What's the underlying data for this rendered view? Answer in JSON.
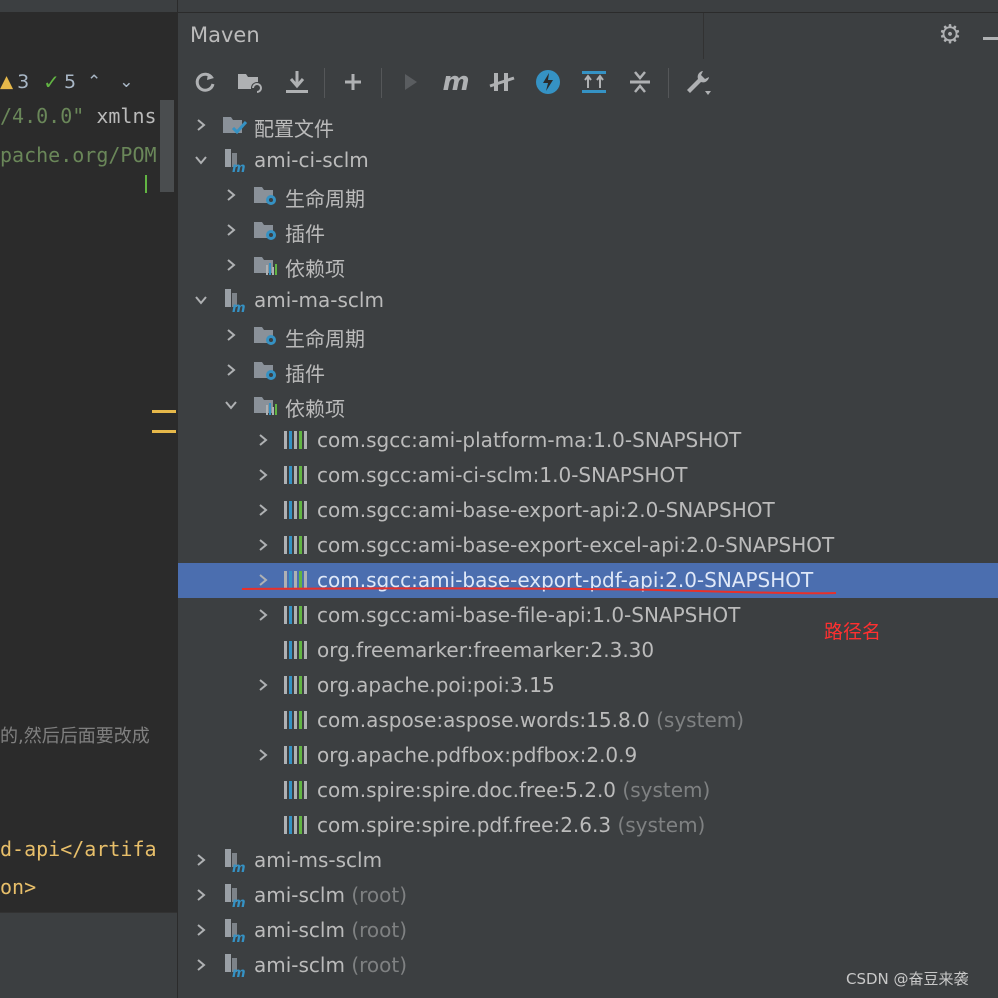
{
  "editor": {
    "inspection": {
      "warnings": "3",
      "checks": "5"
    },
    "code_lines": [
      {
        "text": "/4.0.0\"",
        "kind": "str"
      },
      {
        "text": " xmlns",
        "kind": "attr"
      },
      {
        "text": "pache.org/POM",
        "kind": "str"
      },
      {
        "text": "d-api</artifa",
        "kind": "tag"
      },
      {
        "text": "on>",
        "kind": "tag"
      }
    ],
    "comment": "的,然后后面要改成"
  },
  "maven": {
    "title": "Maven",
    "toolbar": [
      {
        "name": "reload-icon"
      },
      {
        "name": "generate-sources-icon"
      },
      {
        "name": "download-icon"
      },
      {
        "name": "add-icon"
      },
      {
        "name": "run-icon"
      },
      {
        "name": "execute-goal-icon",
        "text": "m"
      },
      {
        "name": "toggle-offline-icon"
      },
      {
        "name": "skip-tests-icon"
      },
      {
        "name": "show-dependencies-icon"
      },
      {
        "name": "collapse-all-icon"
      },
      {
        "name": "settings-wrench-icon"
      }
    ],
    "tree": [
      {
        "label": "配置文件",
        "icon": "profiles",
        "arrow": "collapsed",
        "level": 0
      },
      {
        "label": "ami-ci-sclm",
        "icon": "module",
        "arrow": "expanded",
        "level": 0
      },
      {
        "label": "生命周期",
        "icon": "folder-gear",
        "arrow": "collapsed",
        "level": 1
      },
      {
        "label": "插件",
        "icon": "folder-gear",
        "arrow": "collapsed",
        "level": 1
      },
      {
        "label": "依赖项",
        "icon": "folder-deps",
        "arrow": "collapsed",
        "level": 1
      },
      {
        "label": "ami-ma-sclm",
        "icon": "module",
        "arrow": "expanded",
        "level": 0
      },
      {
        "label": "生命周期",
        "icon": "folder-gear",
        "arrow": "collapsed",
        "level": 1
      },
      {
        "label": "插件",
        "icon": "folder-gear",
        "arrow": "collapsed",
        "level": 1
      },
      {
        "label": "依赖项",
        "icon": "folder-deps",
        "arrow": "expanded",
        "level": 1
      },
      {
        "label": "com.sgcc:ami-platform-ma:1.0-SNAPSHOT",
        "icon": "lib",
        "arrow": "collapsed",
        "level": 2
      },
      {
        "label": "com.sgcc:ami-ci-sclm:1.0-SNAPSHOT",
        "icon": "lib",
        "arrow": "collapsed",
        "level": 2
      },
      {
        "label": "com.sgcc:ami-base-export-api:2.0-SNAPSHOT",
        "icon": "lib",
        "arrow": "collapsed",
        "level": 2
      },
      {
        "label": "com.sgcc:ami-base-export-excel-api:2.0-SNAPSHOT",
        "icon": "lib",
        "arrow": "collapsed",
        "level": 2
      },
      {
        "label": "com.sgcc:ami-base-export-pdf-api:2.0-SNAPSHOT",
        "icon": "lib",
        "arrow": "collapsed",
        "level": 2,
        "selected": true
      },
      {
        "label": "com.sgcc:ami-base-file-api:1.0-SNAPSHOT",
        "icon": "lib",
        "arrow": "collapsed",
        "level": 2
      },
      {
        "label": "org.freemarker:freemarker:2.3.30",
        "icon": "lib",
        "arrow": "none",
        "level": 2
      },
      {
        "label": "org.apache.poi:poi:3.15",
        "icon": "lib",
        "arrow": "collapsed",
        "level": 2
      },
      {
        "label": "com.aspose:aspose.words:15.8.0",
        "suffix": "(system)",
        "icon": "lib",
        "arrow": "none",
        "level": 2
      },
      {
        "label": "org.apache.pdfbox:pdfbox:2.0.9",
        "icon": "lib",
        "arrow": "collapsed",
        "level": 2
      },
      {
        "label": "com.spire:spire.doc.free:5.2.0",
        "suffix": "(system)",
        "icon": "lib",
        "arrow": "none",
        "level": 2
      },
      {
        "label": "com.spire:spire.pdf.free:2.6.3",
        "suffix": "(system)",
        "icon": "lib",
        "arrow": "none",
        "level": 2
      },
      {
        "label": "ami-ms-sclm",
        "icon": "module",
        "arrow": "collapsed",
        "level": 0
      },
      {
        "label": "ami-sclm",
        "suffix": "(root)",
        "icon": "module",
        "arrow": "collapsed",
        "level": 0
      },
      {
        "label": "ami-sclm",
        "suffix": "(root)",
        "icon": "module",
        "arrow": "collapsed",
        "level": 0
      },
      {
        "label": "ami-sclm",
        "suffix": "(root)",
        "icon": "module",
        "arrow": "collapsed",
        "level": 0
      }
    ]
  },
  "annotation": "路径名",
  "watermark": "CSDN @奋豆来袭",
  "colors": {
    "selection": "#4b6eaf",
    "annotation": "#ff3030",
    "accent_blue": "#3592c4"
  }
}
